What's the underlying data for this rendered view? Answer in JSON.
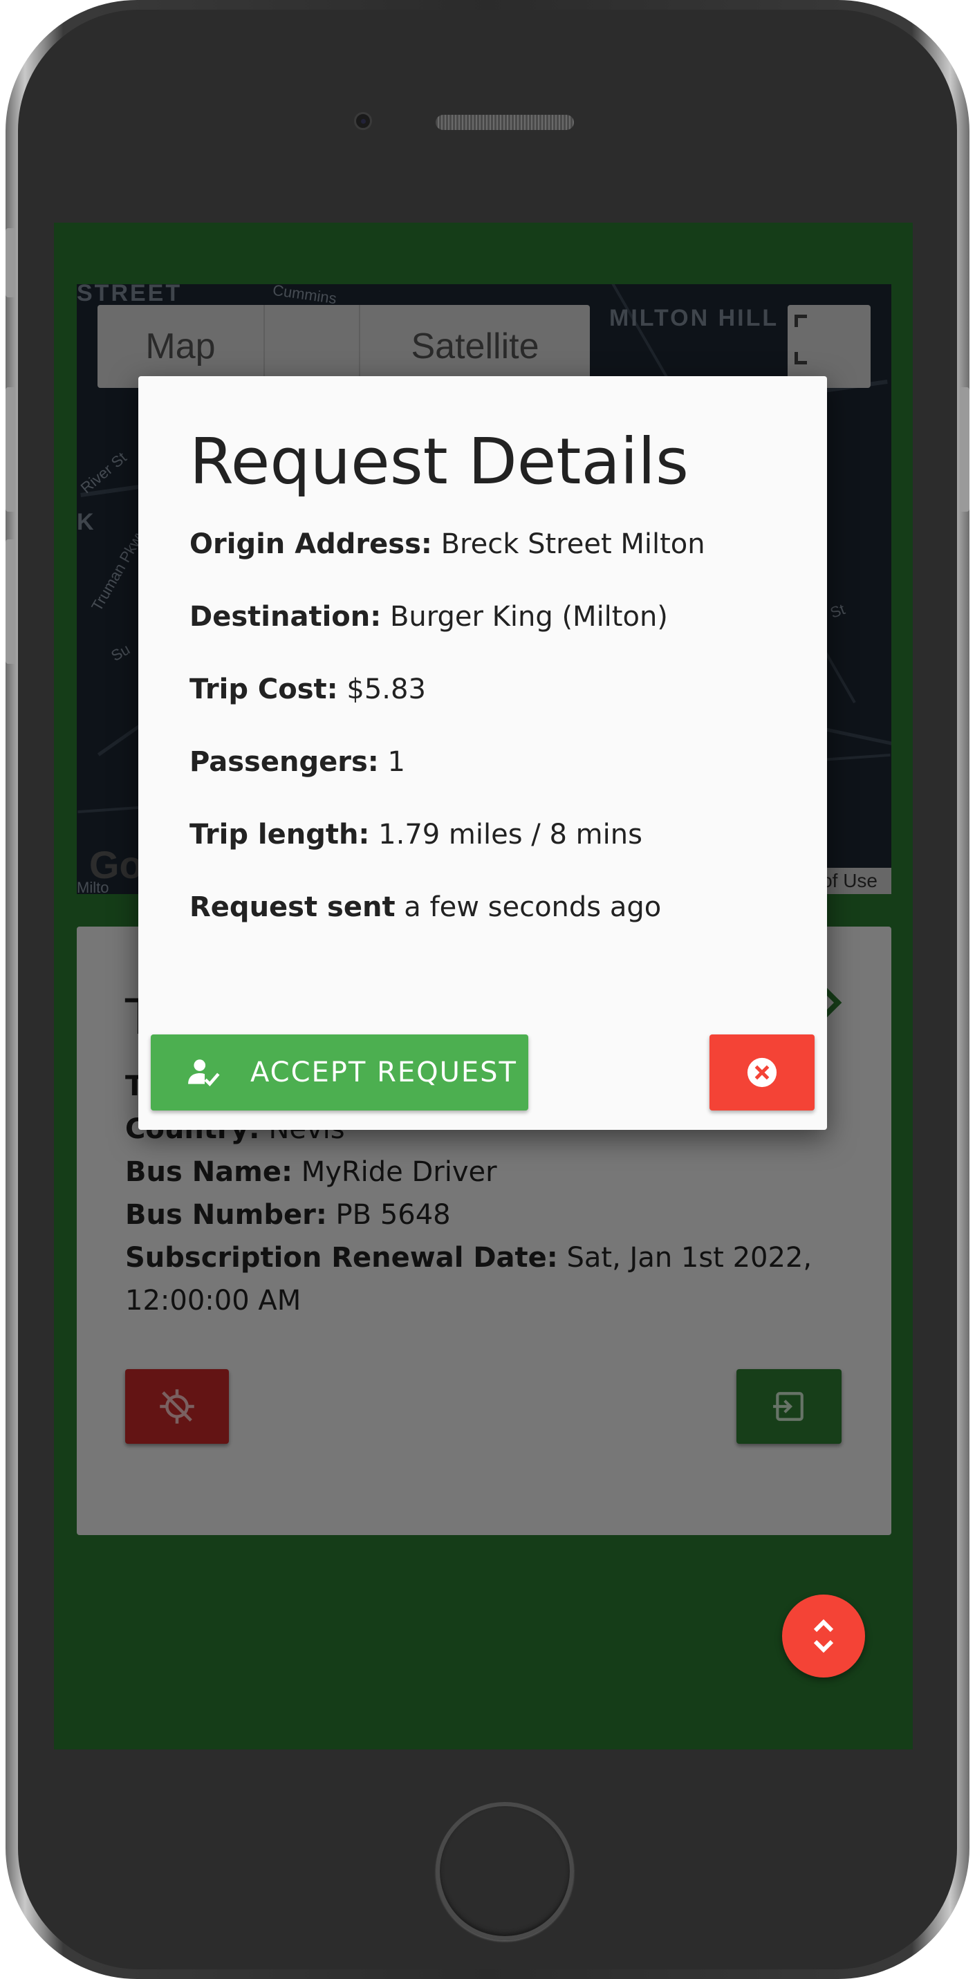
{
  "map": {
    "type_options": [
      "Map",
      "Satellite"
    ],
    "terms_label": "of Use",
    "logo": "Go",
    "street_labels": [
      "STREET",
      "MILTON HILL",
      "Cummins",
      "River St",
      "Truman Pkwy",
      "K",
      "Su",
      "Milto",
      "St"
    ]
  },
  "modal": {
    "title": "Request Details",
    "details": [
      {
        "key": "Origin Address:",
        "value": "Breck Street Milton"
      },
      {
        "key": "Destination:",
        "value": "Burger King (Milton)"
      },
      {
        "key": "Trip Cost:",
        "value": "$5.83"
      },
      {
        "key": "Passengers:",
        "value": "1"
      },
      {
        "key": "Trip length:",
        "value": "1.79 miles / 8 mins"
      },
      {
        "key": "Request sent",
        "value": "a few seconds ago"
      }
    ],
    "accept_label": "ACCEPT REQUEST",
    "accept_icon": "person-check-icon",
    "decline_icon": "close-circle-icon"
  },
  "profile": {
    "title_partial": "T",
    "line1_partial": "T",
    "country_key": "Country:",
    "country_value": "Nevis",
    "bus_name_key": "Bus Name:",
    "bus_name_value": "MyRide Driver",
    "bus_number_key": "Bus Number:",
    "bus_number_value": "PB 5648",
    "renewal_key": "Subscription Renewal Date:",
    "renewal_value": "Sat, Jan 1st 2022, 12:00:00 AM",
    "offline_icon": "gps-off-icon",
    "logout_icon": "logout-icon"
  },
  "fab": {
    "icon": "unfold-icon"
  },
  "colors": {
    "screen_bg": "#2a7a30",
    "accept": "#4caf50",
    "decline": "#f44336",
    "offline": "#c62828",
    "logout": "#2e7d32",
    "fab": "#f44336"
  }
}
